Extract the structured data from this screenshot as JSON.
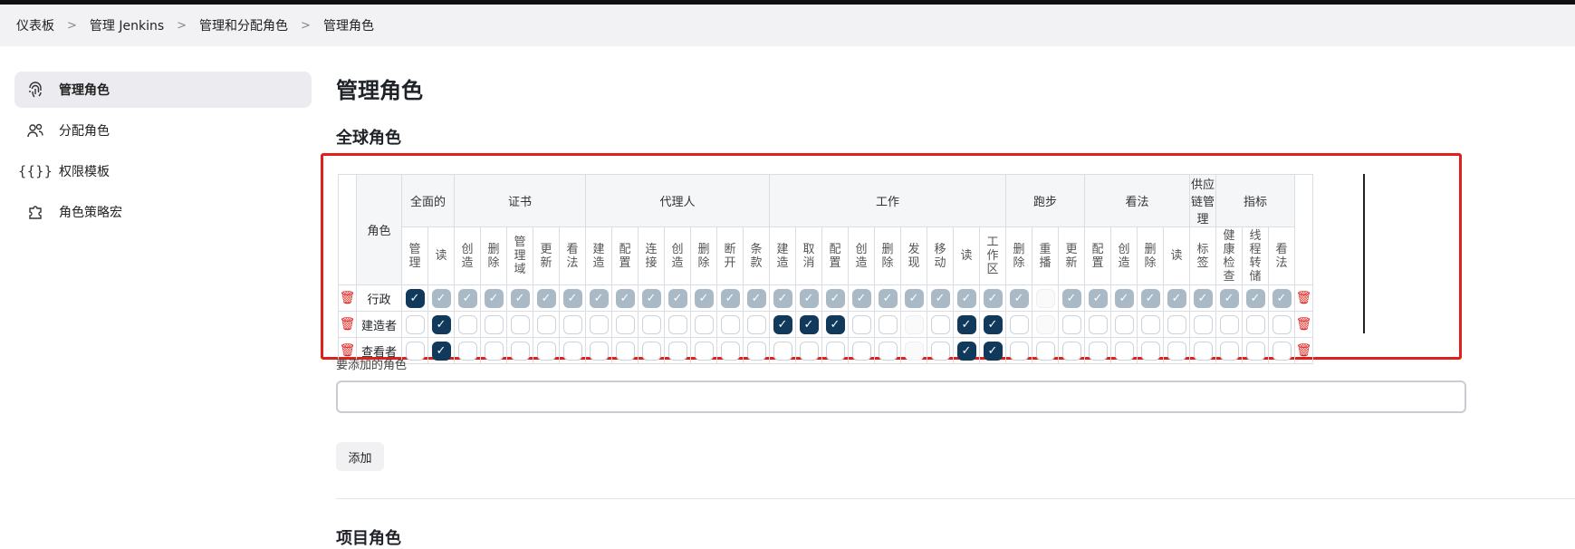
{
  "breadcrumb": [
    "仪表板",
    "管理 Jenkins",
    "管理和分配角色",
    "管理角色"
  ],
  "sidebar": {
    "items": [
      {
        "label": "管理角色",
        "icon": "fingerprint-icon",
        "active": true
      },
      {
        "label": "分配角色",
        "icon": "users-icon",
        "active": false
      },
      {
        "label": "权限模板",
        "icon": "braces-icon",
        "active": false
      },
      {
        "label": "角色策略宏",
        "icon": "puzzle-icon",
        "active": false
      }
    ]
  },
  "page_title": "管理角色",
  "section_title": "全球角色",
  "grid": {
    "role_header": "角色",
    "groups": [
      {
        "name": "全面的",
        "perms": [
          "管理",
          "读"
        ]
      },
      {
        "name": "证书",
        "perms": [
          "创造",
          "删除",
          "管理域",
          "更新",
          "看法"
        ]
      },
      {
        "name": "代理人",
        "perms": [
          "建造",
          "配置",
          "连接",
          "创造",
          "删除",
          "断开",
          "条款"
        ]
      },
      {
        "name": "工作",
        "perms": [
          "建造",
          "取消",
          "配置",
          "创造",
          "删除",
          "发现",
          "移动",
          "读",
          "工作区"
        ]
      },
      {
        "name": "跑步",
        "perms": [
          "删除",
          "重播",
          "更新"
        ]
      },
      {
        "name": "看法",
        "perms": [
          "配置",
          "创造",
          "删除",
          "读"
        ]
      },
      {
        "name": "供应链管理",
        "perms": [
          "标签"
        ]
      },
      {
        "name": "指标",
        "perms": [
          "健康检查",
          "线程转储",
          "看法"
        ]
      }
    ],
    "legend": {
      "on": "checked",
      "inh": "implied-by-admin",
      "off": "unchecked",
      "dis": "disabled"
    },
    "roles": [
      {
        "name": "行政",
        "cells": [
          "on",
          "inh",
          "inh",
          "inh",
          "inh",
          "inh",
          "inh",
          "inh",
          "inh",
          "inh",
          "inh",
          "inh",
          "inh",
          "inh",
          "inh",
          "inh",
          "inh",
          "inh",
          "inh",
          "inh",
          "inh",
          "inh",
          "inh",
          "inh",
          "dis",
          "inh",
          "inh",
          "inh",
          "inh",
          "inh",
          "inh",
          "inh",
          "inh",
          "inh"
        ]
      },
      {
        "name": "建造者",
        "cells": [
          "off",
          "on",
          "off",
          "off",
          "off",
          "off",
          "off",
          "off",
          "off",
          "off",
          "off",
          "off",
          "off",
          "off",
          "on",
          "on",
          "on",
          "off",
          "off",
          "dis",
          "off",
          "on",
          "on",
          "off",
          "dis",
          "off",
          "off",
          "off",
          "off",
          "off",
          "off",
          "off",
          "off",
          "off"
        ]
      },
      {
        "name": "查看者",
        "cells": [
          "off",
          "on",
          "off",
          "off",
          "off",
          "off",
          "off",
          "off",
          "off",
          "off",
          "off",
          "off",
          "off",
          "off",
          "off",
          "off",
          "off",
          "off",
          "off",
          "dis",
          "off",
          "on",
          "on",
          "off",
          "off",
          "off",
          "off",
          "off",
          "off",
          "off",
          "off",
          "off",
          "off",
          "off"
        ]
      }
    ],
    "check_glyph": "✓",
    "trash_glyph": "🗑"
  },
  "add_role": {
    "label": "要添加的角色",
    "placeholder": "",
    "button": "添加"
  },
  "project_section_title": "项目角色",
  "colors": {
    "checked": "#10395b",
    "implied": "#a9bac6",
    "highlight_border": "#e0201b",
    "trash": "#e0201b"
  }
}
